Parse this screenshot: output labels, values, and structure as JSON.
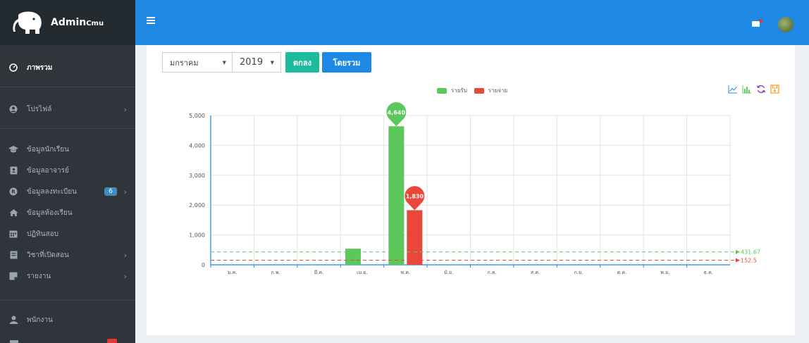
{
  "brand": {
    "name": "Admin",
    "sub": "Cmu",
    "logo_icon": "elephant-icon"
  },
  "sidebar": {
    "items": [
      {
        "label": "ภาพรวม",
        "icon": "dashboard-icon",
        "active": true
      },
      {
        "label": "โปรไฟล์",
        "icon": "user-icon",
        "chevron": true
      },
      {
        "label": "ข้อมูลนักเรียน",
        "icon": "graduation-cap-icon"
      },
      {
        "label": "ข้อมูลอาจารย์",
        "icon": "address-book-icon"
      },
      {
        "label": "ข้อมูลลงทะเบียน",
        "icon": "registered-icon",
        "badge": "6",
        "chevron": true
      },
      {
        "label": "ข้อมูลห้องเรียน",
        "icon": "home-icon"
      },
      {
        "label": "ปฏิทินสอบ",
        "icon": "calendar-icon"
      },
      {
        "label": "วิชาที่เปิดสอน",
        "icon": "book-icon",
        "chevron": true
      },
      {
        "label": "รายงาน",
        "icon": "report-icon",
        "chevron": true
      },
      {
        "label": "พนักงาน",
        "icon": "employee-icon"
      }
    ]
  },
  "topbar": {
    "menu_icon": "hamburger-icon",
    "mail_icon": "mail-icon",
    "avatar_icon": "avatar-icon"
  },
  "filters": {
    "month": "มกราคม",
    "year": "2019",
    "submit_label": "ตกลง",
    "overall_label": "โดยรวม"
  },
  "colors": {
    "income": "#5cc85c",
    "expense": "#e8473a",
    "topbar": "#1e88e5",
    "teal": "#1abc9c",
    "blue": "#1e88e5"
  },
  "chart_data": {
    "type": "bar",
    "categories": [
      "ม.ค.",
      "ก.พ.",
      "มี.ค.",
      "เม.ย.",
      "พ.ค.",
      "มิ.ย.",
      "ก.ค.",
      "ส.ค.",
      "ก.ย.",
      "ต.ค.",
      "พ.ย.",
      "ธ.ค."
    ],
    "series": [
      {
        "name": "รายรับ",
        "color": "#5cc85c",
        "values": [
          0,
          0,
          0,
          540,
          4640,
          0,
          0,
          0,
          0,
          0,
          0,
          0
        ]
      },
      {
        "name": "รายจ่าย",
        "color": "#e8473a",
        "values": [
          0,
          0,
          0,
          0,
          1830,
          0,
          0,
          0,
          0,
          0,
          0,
          0
        ]
      }
    ],
    "markpoints": [
      {
        "series": 0,
        "category": 4,
        "label": "4,640"
      },
      {
        "series": 1,
        "category": 4,
        "label": "1,830"
      }
    ],
    "marklines": [
      {
        "series": 0,
        "value": 431.67,
        "label": "431.67"
      },
      {
        "series": 1,
        "value": 152.5,
        "label": "152.5"
      }
    ],
    "yticks": [
      "0",
      "1,000",
      "2,000",
      "3,000",
      "4,000",
      "5,000"
    ],
    "ylim": [
      0,
      5000
    ],
    "grid": true,
    "legend_position": "top-center"
  },
  "toolbox": [
    {
      "icon": "line-chart-icon",
      "color": "#1e88e5"
    },
    {
      "icon": "bar-chart-icon",
      "color": "#5cc85c"
    },
    {
      "icon": "refresh-icon",
      "color": "#8e44ad"
    },
    {
      "icon": "save-image-icon",
      "color": "#f39c12"
    }
  ]
}
